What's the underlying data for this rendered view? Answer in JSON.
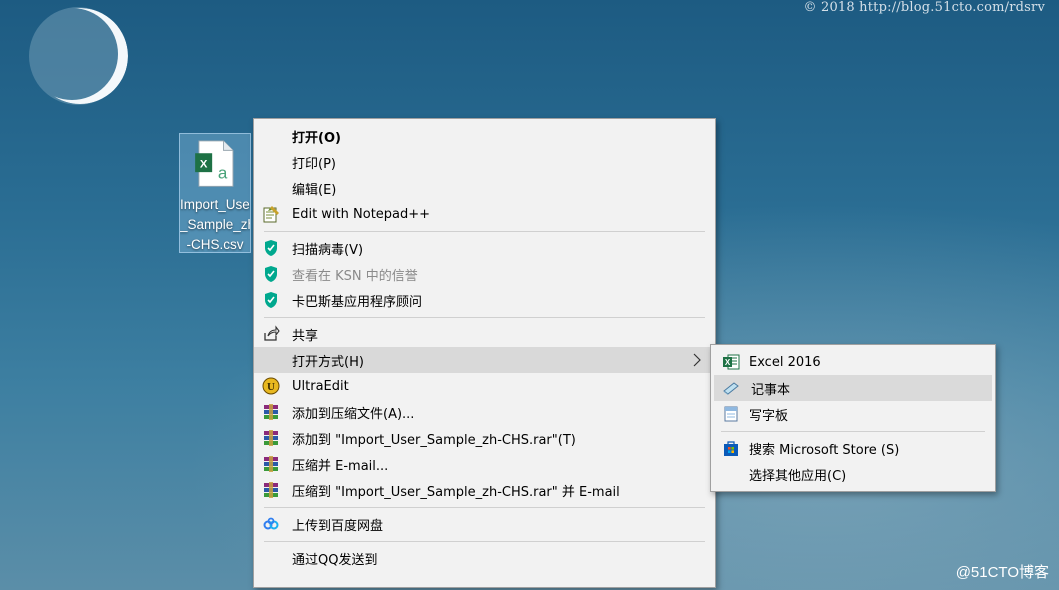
{
  "watermark_top": "© 2018 http://blog.51cto.com/rdsrv",
  "watermark_bottom": "@51CTO博客",
  "desktop_icon": {
    "label_lines": [
      "Import_User",
      "_Sample_zh",
      "-CHS.csv"
    ]
  },
  "main_menu": {
    "items": [
      {
        "label": "打开(O)",
        "icon": "none"
      },
      {
        "label": "打印(P)",
        "icon": "none"
      },
      {
        "label": "编辑(E)",
        "icon": "none"
      },
      {
        "label": "Edit with Notepad++",
        "icon": "notepadpp-icon"
      },
      {
        "label": "扫描病毒(V)",
        "icon": "kaspersky-shield-icon"
      },
      {
        "label": "查看在 KSN 中的信誉",
        "icon": "kaspersky-shield-icon"
      },
      {
        "label": "卡巴斯基应用程序顾问",
        "icon": "kaspersky-shield-icon"
      },
      {
        "label": "共享",
        "icon": "share-icon"
      },
      {
        "label": "打开方式(H)",
        "icon": "none"
      },
      {
        "label": "UltraEdit",
        "icon": "ultraedit-icon"
      },
      {
        "label": "添加到压缩文件(A)...",
        "icon": "winrar-icon"
      },
      {
        "label": "添加到 \"Import_User_Sample_zh-CHS.rar\"(T)",
        "icon": "winrar-icon"
      },
      {
        "label": "压缩并 E-mail...",
        "icon": "winrar-icon"
      },
      {
        "label": "压缩到 \"Import_User_Sample_zh-CHS.rar\" 并 E-mail",
        "icon": "winrar-icon"
      },
      {
        "label": "上传到百度网盘",
        "icon": "baidu-netdisk-icon"
      },
      {
        "label": "通过QQ发送到",
        "icon": "none"
      }
    ]
  },
  "open_with_menu": {
    "items": [
      {
        "label": "Excel 2016",
        "icon": "excel-icon"
      },
      {
        "label": "记事本",
        "icon": "notepad-icon"
      },
      {
        "label": "写字板",
        "icon": "wordpad-icon"
      },
      {
        "label": "搜索 Microsoft Store (S)",
        "icon": "microsoft-store-icon"
      },
      {
        "label": "选择其他应用(C)",
        "icon": "none"
      }
    ]
  },
  "colors": {
    "kaspersky_green": "#00a88e",
    "excel_green": "#1e7145",
    "menu_bg": "#f2f2f2",
    "hover_bg": "#d9d9d9"
  }
}
